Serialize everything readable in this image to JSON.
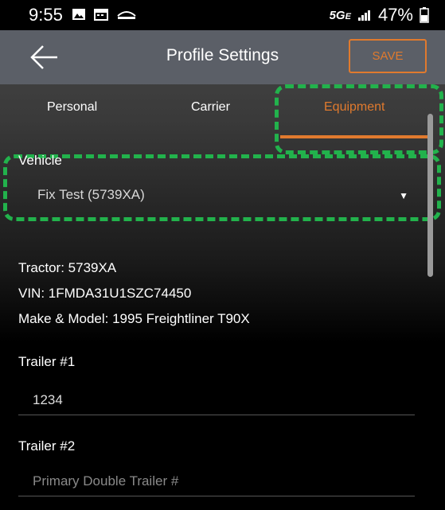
{
  "status_bar": {
    "time": "9:55",
    "network": "5G",
    "network_sub": "E",
    "battery": "47%"
  },
  "header": {
    "title": "Profile Settings",
    "save_label": "SAVE"
  },
  "tabs": [
    {
      "label": "Personal"
    },
    {
      "label": "Carrier"
    },
    {
      "label": "Equipment"
    }
  ],
  "vehicle": {
    "label": "Vehicle",
    "value": "Fix Test (5739XA)"
  },
  "details": {
    "tractor": "Tractor: 5739XA",
    "vin": "VIN: 1FMDA31U1SZC74450",
    "make_model": "Make & Model: 1995 Freightliner T90X"
  },
  "trailer1": {
    "label": "Trailer #1",
    "value": "1234"
  },
  "trailer2": {
    "label": "Trailer #2",
    "placeholder": "Primary Double Trailer #"
  },
  "colors": {
    "accent": "#e07a2e",
    "highlight": "#22b24c"
  }
}
